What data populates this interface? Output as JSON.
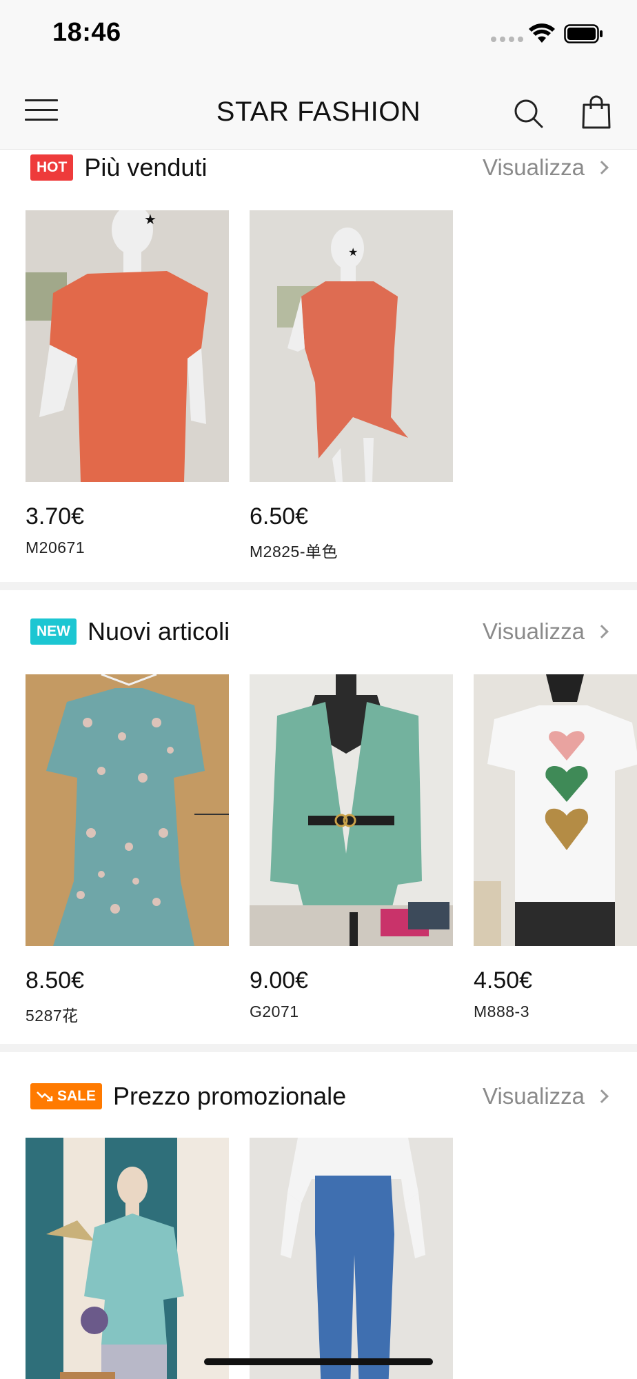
{
  "status_bar": {
    "time": "18:46"
  },
  "header": {
    "title": "STAR FASHION"
  },
  "sections": [
    {
      "badge": "HOT",
      "title": "Più venduti",
      "view_all": "Visualizza",
      "products": [
        {
          "price": "3.70€",
          "sku": "M20671"
        },
        {
          "price": "6.50€",
          "sku": "M2825-单色"
        }
      ]
    },
    {
      "badge": "NEW",
      "title": "Nuovi articoli",
      "view_all": "Visualizza",
      "products": [
        {
          "price": "8.50€",
          "sku": "5287花"
        },
        {
          "price": "9.00€",
          "sku": "G2071"
        },
        {
          "price": "4.50€",
          "sku": "M888-3"
        }
      ]
    },
    {
      "badge": "SALE",
      "title": "Prezzo promozionale",
      "view_all": "Visualizza",
      "products": [
        {
          "price": "",
          "sku": ""
        },
        {
          "price": "",
          "sku": ""
        }
      ]
    }
  ],
  "colors": {
    "hot": "#ee3b3b",
    "new": "#1cc6d2",
    "sale": "#ff7a00"
  }
}
